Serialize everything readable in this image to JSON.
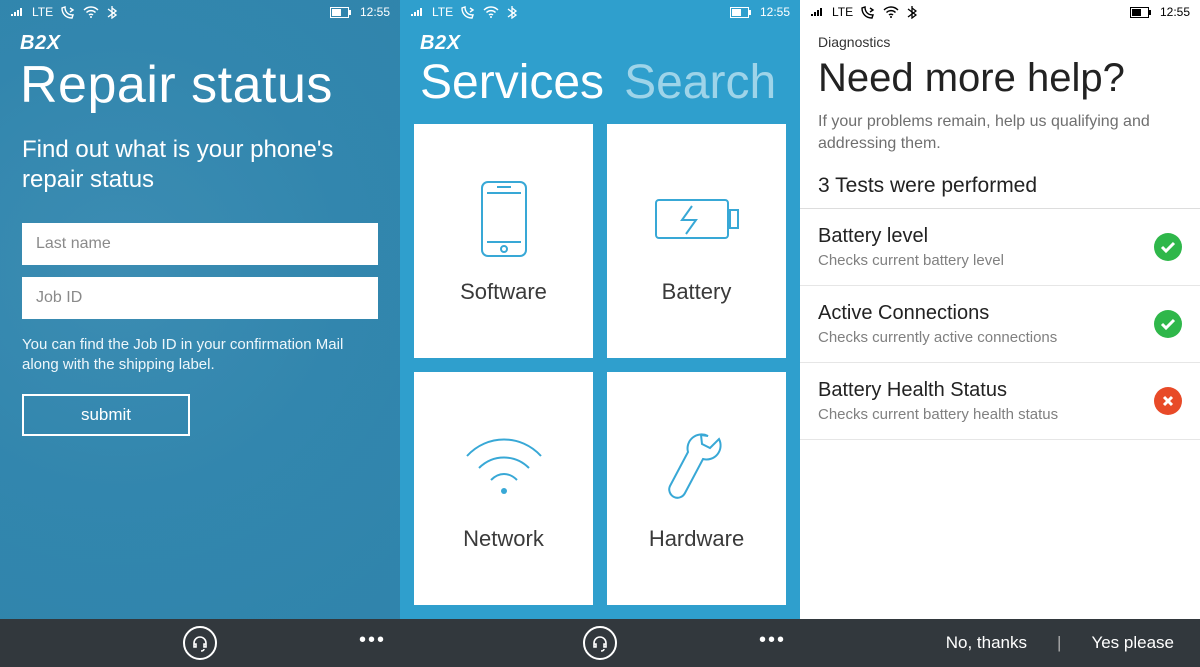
{
  "statusbar": {
    "network": "LTE",
    "time": "12:55"
  },
  "screen1": {
    "brand": "B2X",
    "title": "Repair status",
    "subtitle": "Find out what is your phone's repair status",
    "lastname_placeholder": "Last name",
    "jobid_placeholder": "Job ID",
    "hint": "You can find the Job ID in your confirmation Mail along with the shipping label.",
    "submit": "submit"
  },
  "screen2": {
    "brand": "B2X",
    "tab_active": "Services",
    "tab_inactive": "Search",
    "tiles": {
      "software": "Software",
      "battery": "Battery",
      "network": "Network",
      "hardware": "Hardware"
    }
  },
  "screen3": {
    "crumb": "Diagnostics",
    "title": "Need more help?",
    "lead": "If your problems remain, help us qualifying and addressing them.",
    "summary": "3 Tests were performed",
    "tests": [
      {
        "title": "Battery level",
        "desc": "Checks current battery level",
        "status": "pass"
      },
      {
        "title": "Active Connections",
        "desc": "Checks currently active connections",
        "status": "pass"
      },
      {
        "title": "Battery Health Status",
        "desc": "Checks current battery health status",
        "status": "fail"
      }
    ],
    "actions": {
      "no": "No, thanks",
      "yes": "Yes please"
    }
  }
}
